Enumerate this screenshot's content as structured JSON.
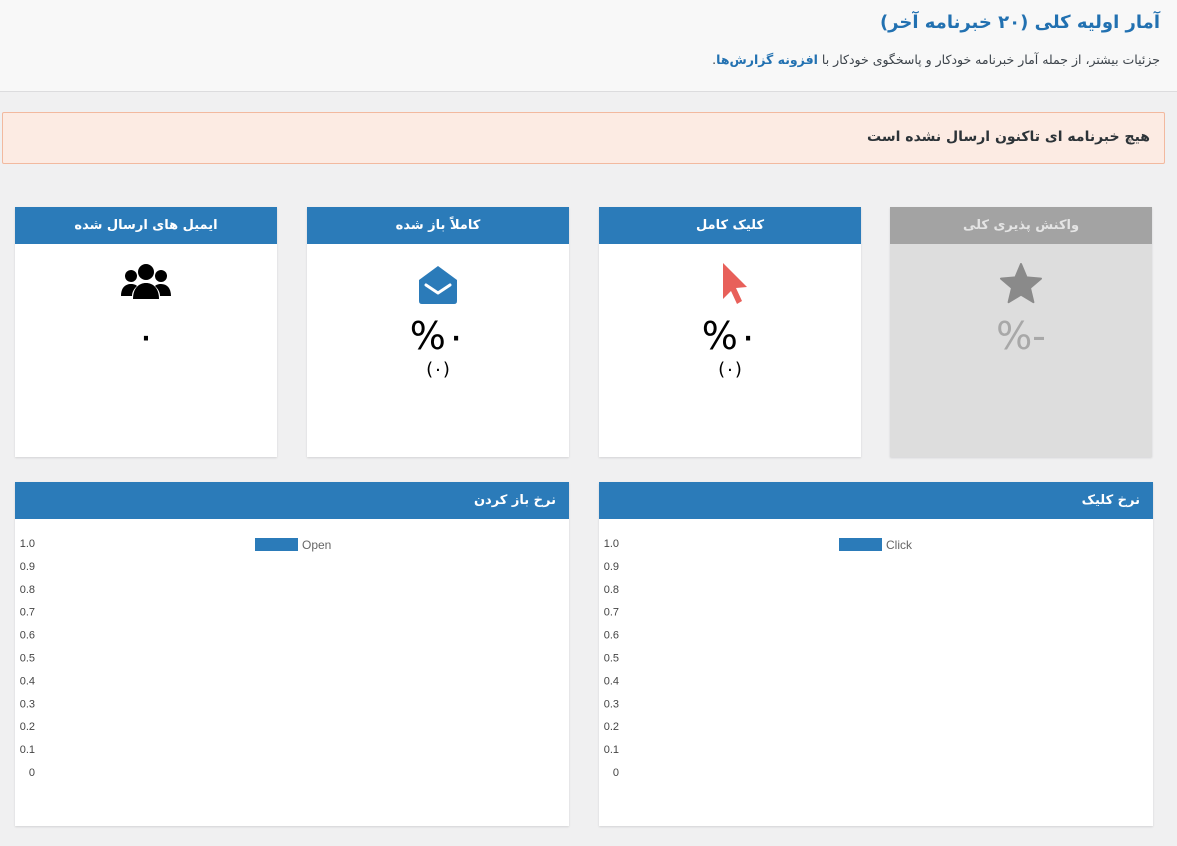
{
  "header": {
    "title": "آمار اولیه کلی (۲۰ خبرنامه آخر)",
    "subtitle_prefix": "جزئیات بیشتر، از جمله آمار خبرنامه خودکار و پاسخگوی خودکار با",
    "subtitle_link": "افزونه گزارش‌ها",
    "subtitle_suffix": "."
  },
  "notice": {
    "text": "هیچ خبرنامه ای تاکنون ارسال نشده است"
  },
  "cards": [
    {
      "title": "ایمیل های ارسال شده",
      "icon": "users-icon",
      "value": "۰",
      "sub": ""
    },
    {
      "title": "کاملاً باز شده",
      "icon": "envelope-open-icon",
      "value": "%۰",
      "sub": "(۰)"
    },
    {
      "title": "کلیک کامل",
      "icon": "cursor-icon",
      "value": "%۰",
      "sub": "(۰)"
    },
    {
      "title": "واکنش پذیری کلی",
      "icon": "star-icon",
      "value": "%-",
      "sub": ""
    }
  ],
  "colors": {
    "accent": "#2b7bb9",
    "cursor": "#e8605a",
    "disabled": "#a3a3a3"
  },
  "charts_titles": {
    "open": "نرخ باز کردن",
    "click": "نرخ کلیک"
  },
  "chart_data": [
    {
      "type": "bar",
      "title": "نرخ باز کردن",
      "categories": [],
      "series": [
        {
          "name": "Open",
          "values": []
        }
      ],
      "ylim": [
        0,
        1.0
      ],
      "yticks": [
        "1.0",
        "0.9",
        "0.8",
        "0.7",
        "0.6",
        "0.5",
        "0.4",
        "0.3",
        "0.2",
        "0.1",
        "0"
      ],
      "legend": "top-center",
      "grid": false
    },
    {
      "type": "bar",
      "title": "نرخ کلیک",
      "categories": [],
      "series": [
        {
          "name": "Click",
          "values": []
        }
      ],
      "ylim": [
        0,
        1.0
      ],
      "yticks": [
        "1.0",
        "0.9",
        "0.8",
        "0.7",
        "0.6",
        "0.5",
        "0.4",
        "0.3",
        "0.2",
        "0.1",
        "0"
      ],
      "legend": "top-center",
      "grid": false
    }
  ]
}
